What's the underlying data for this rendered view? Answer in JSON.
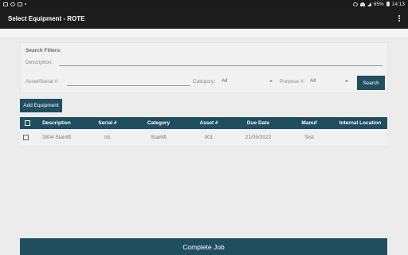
{
  "status_bar": {
    "battery": "65%",
    "time": "14:13"
  },
  "app_bar": {
    "title": "Select Equipment - ROTE"
  },
  "filters": {
    "title": "Search Filters:",
    "description_label": "Description:",
    "description_value": "",
    "asset_label": "Asset/Serial #:",
    "asset_value": "",
    "category_label": "Category:",
    "category_value": "All",
    "purpose_label": "Purpose #:",
    "purpose_value": "All",
    "search_label": "Search"
  },
  "add_equipment_label": "Add Equipment",
  "table": {
    "headers": {
      "description": "Description",
      "serial": "Serial #",
      "category": "Category",
      "asset": "Asset #",
      "due_date": "Due Date",
      "manuf": "Manuf",
      "location": "Internal Location"
    },
    "rows": [
      {
        "description": "2804 Stairlift",
        "serial": "001",
        "category": "Stairlift",
        "asset": "001",
        "due_date": "21/05/2022",
        "manuf": "Test",
        "location": ""
      }
    ]
  },
  "complete_label": "Complete Job",
  "colors": {
    "accent": "#1f4e5f",
    "app_bar": "#1d1d1d",
    "background": "#ececec"
  }
}
